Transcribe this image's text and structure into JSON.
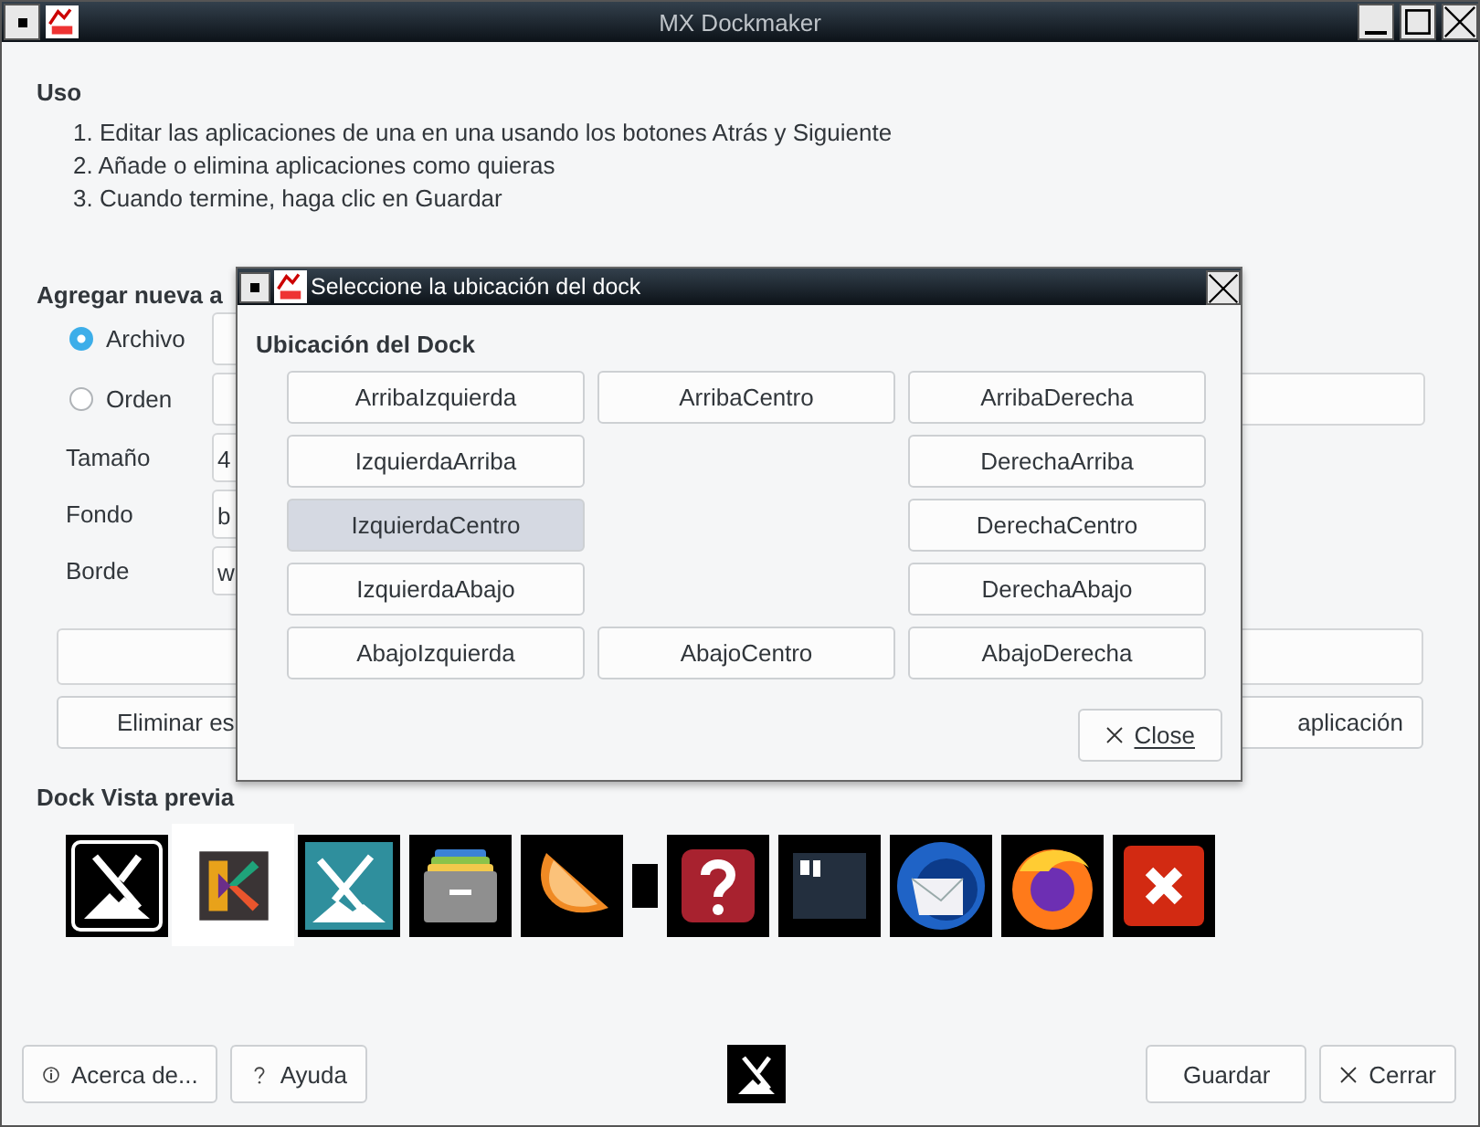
{
  "window": {
    "title": "MX Dockmaker"
  },
  "usage": {
    "heading": "Uso",
    "steps": [
      "1. Editar las aplicaciones de una en una usando los botones Atrás y Siguiente",
      "2. Añade o elimina aplicaciones como quieras",
      "3. Cuando termine, haga clic en Guardar"
    ]
  },
  "add_app": {
    "heading": "Agregar nueva a",
    "sources": [
      {
        "label": "Archivo",
        "selected": true
      },
      {
        "label": "Orden",
        "selected": false
      }
    ],
    "fields": [
      {
        "label": "Tamaño",
        "value": "4"
      },
      {
        "label": "Fondo",
        "value": "b"
      },
      {
        "label": "Borde",
        "value": "w"
      }
    ]
  },
  "actions": [
    "Eliminar es",
    "aplicación"
  ],
  "preview": {
    "heading": "Dock Vista previa",
    "items": [
      {
        "kind": "mx",
        "selected": false
      },
      {
        "kind": "kvantum",
        "selected": true
      },
      {
        "kind": "tools",
        "selected": false
      },
      {
        "kind": "archive",
        "selected": false
      },
      {
        "kind": "orange",
        "selected": false
      },
      {
        "kind": "separator",
        "selected": false
      },
      {
        "kind": "help",
        "selected": false
      },
      {
        "kind": "terminal",
        "selected": false
      },
      {
        "kind": "mail",
        "selected": false
      },
      {
        "kind": "browser",
        "selected": false
      },
      {
        "kind": "quit",
        "selected": false
      }
    ]
  },
  "footer": {
    "about": "Acerca de...",
    "help": "Ayuda",
    "save": "Guardar",
    "close": "Cerrar"
  },
  "dialog": {
    "title": "Seleccione la ubicación del dock",
    "heading": "Ubicación del Dock",
    "close": "Close",
    "rows": [
      [
        {
          "kind": "button",
          "label": "ArribaIzquierda",
          "selected": false
        },
        {
          "kind": "button",
          "label": "ArribaCentro",
          "selected": false
        },
        {
          "kind": "button",
          "label": "ArribaDerecha",
          "selected": false
        }
      ],
      [
        {
          "kind": "button",
          "label": "IzquierdaArriba",
          "selected": false
        },
        {
          "kind": "empty"
        },
        {
          "kind": "button",
          "label": "DerechaArriba",
          "selected": false
        }
      ],
      [
        {
          "kind": "button",
          "label": "IzquierdaCentro",
          "selected": true
        },
        {
          "kind": "empty"
        },
        {
          "kind": "button",
          "label": "DerechaCentro",
          "selected": false
        }
      ],
      [
        {
          "kind": "button",
          "label": "IzquierdaAbajo",
          "selected": false
        },
        {
          "kind": "empty"
        },
        {
          "kind": "button",
          "label": "DerechaAbajo",
          "selected": false
        }
      ],
      [
        {
          "kind": "button",
          "label": "AbajoIzquierda",
          "selected": false
        },
        {
          "kind": "button",
          "label": "AbajoCentro",
          "selected": false
        },
        {
          "kind": "button",
          "label": "AbajoDerecha",
          "selected": false
        }
      ]
    ]
  }
}
